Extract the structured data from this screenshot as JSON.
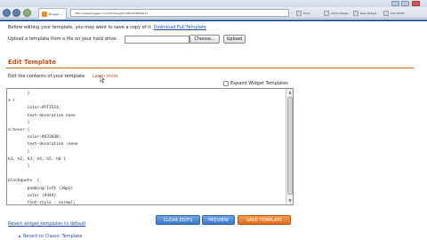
{
  "browser": {
    "tab_title": "Blogger: ...",
    "url": "http://www.blogger.com/html?blogID=4802918256273",
    "right_buttons": [
      "Tools",
      "Admin Pages",
      "New Widget",
      "Pick Width"
    ]
  },
  "page": {
    "top_note_prefix": "Before editing your template, you may want to save a copy of it.",
    "top_note_link": "Download Full Template",
    "upload_label": "Upload a template from a file on your hard drive:",
    "browse_label": "Choose...",
    "upload_button": "Upload",
    "section_title": "Edit Template",
    "edit_description": "Edit the contents of your template.",
    "learn_more": "Learn more",
    "expand_widgets_label": "Expand Widget Templates",
    "expand_widgets_checked": false,
    "code": "        }\na {\n        color:#FF3514;\n        text-decoration none\n        }\na:hover {\n        color:#d23030;\n        text-decoration :none\n        }\nh1, h2, h3, h4, h5, h6 {\n        }\n\nblockquote  {\n        padding-left (10px)\n        color (#444)\n        font-style : normal;\n        }\n.clear {\n        clear:both;\n        }",
    "clear_edits": "CLEAR EDITS",
    "preview": "PREVIEW",
    "save_template": "SAVE TEMPLATE",
    "revert_widgets": "Revert widget templates to default",
    "revert_classic": "Revert to Classic Template"
  },
  "colors": {
    "accent_orange": "#d86a22",
    "link_blue": "#1c4fad",
    "button_blue": "#3c79c6",
    "button_orange": "#e06a1c"
  }
}
